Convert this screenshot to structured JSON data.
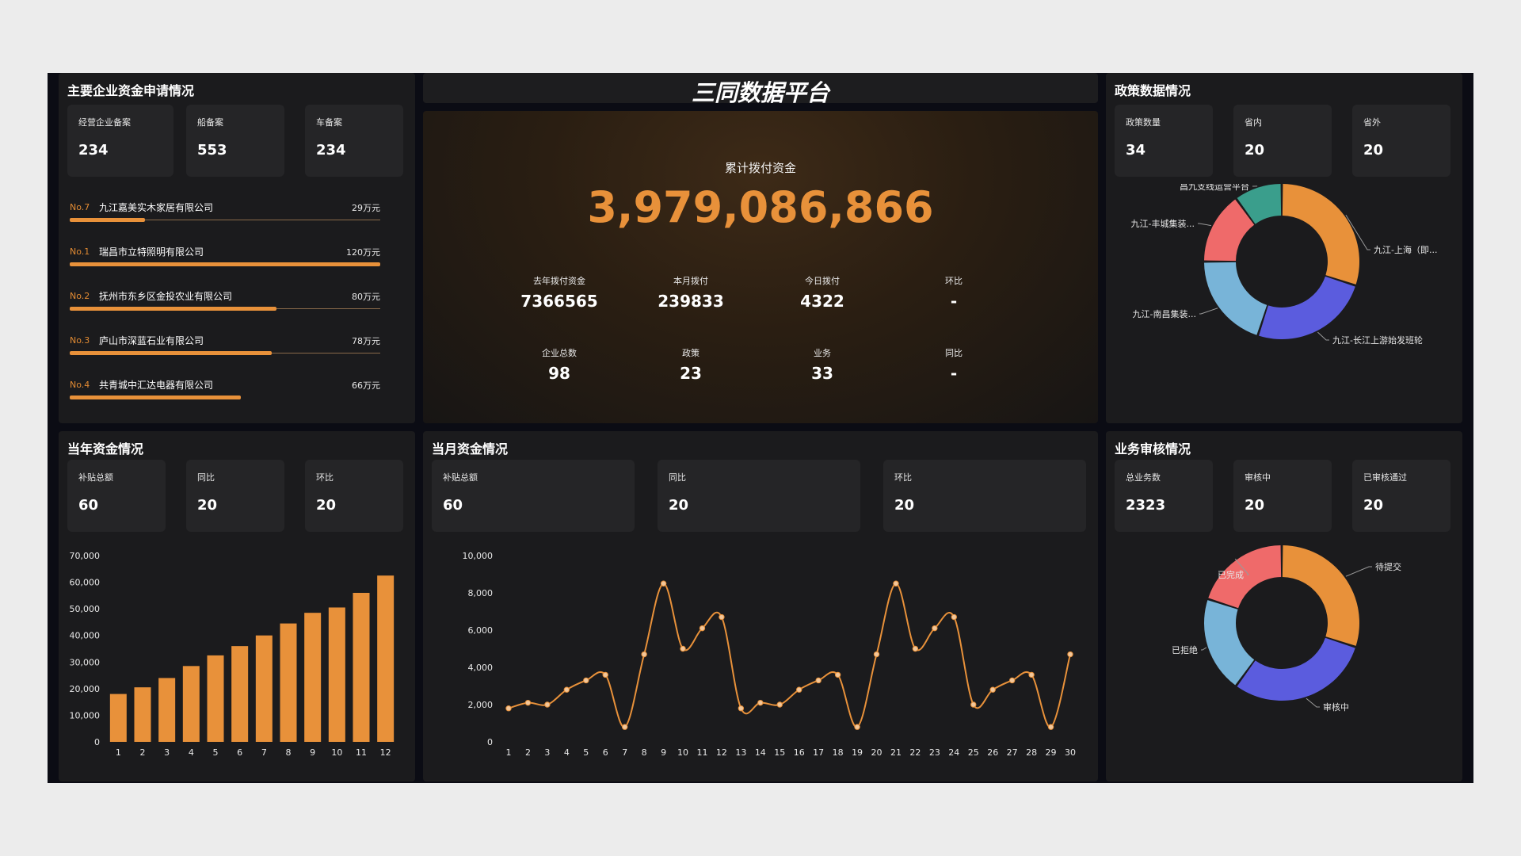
{
  "title": "三同数据平台",
  "colors": {
    "accent": "#e8913a",
    "panel": "#1b1b1d",
    "card": "#252527",
    "donut": [
      "#e8913a",
      "#5b5cde",
      "#78b4d8",
      "#ef6a6a",
      "#3a9e8c"
    ]
  },
  "enterprise": {
    "title": "主要企业资金申请情况",
    "stats": [
      {
        "label": "经营企业备案",
        "value": "234"
      },
      {
        "label": "船备案",
        "value": "553"
      },
      {
        "label": "车备案",
        "value": "234"
      }
    ],
    "ranks": [
      {
        "no": "No.7",
        "name": "九江嘉美实木家居有限公司",
        "amount": "29万元",
        "value": 29
      },
      {
        "no": "No.1",
        "name": "瑞昌市立特照明有限公司",
        "amount": "120万元",
        "value": 120
      },
      {
        "no": "No.2",
        "name": "抚州市东乡区金投农业有限公司",
        "amount": "80万元",
        "value": 80
      },
      {
        "no": "No.3",
        "name": "庐山市深蓝石业有限公司",
        "amount": "78万元",
        "value": 78
      },
      {
        "no": "No.4",
        "name": "共青城中汇达电器有限公司",
        "amount": "66万元",
        "value": 66
      }
    ]
  },
  "center": {
    "label": "累计拨付资金",
    "total": "3,979,086,866",
    "row1": [
      {
        "label": "去年拨付资金",
        "value": "7366565"
      },
      {
        "label": "本月拨付",
        "value": "239833"
      },
      {
        "label": "今日拨付",
        "value": "4322"
      },
      {
        "label": "环比",
        "value": "-"
      }
    ],
    "row2": [
      {
        "label": "企业总数",
        "value": "98"
      },
      {
        "label": "政策",
        "value": "23"
      },
      {
        "label": "业务",
        "value": "33"
      },
      {
        "label": "同比",
        "value": "-"
      }
    ]
  },
  "policy": {
    "title": "政策数据情况",
    "stats": [
      {
        "label": "政策数量",
        "value": "34"
      },
      {
        "label": "省内",
        "value": "20"
      },
      {
        "label": "省外",
        "value": "20"
      }
    ]
  },
  "yearFunds": {
    "title": "当年资金情况",
    "stats": [
      {
        "label": "补贴总额",
        "value": "60"
      },
      {
        "label": "同比",
        "value": "20"
      },
      {
        "label": "环比",
        "value": "20"
      }
    ]
  },
  "monthFunds": {
    "title": "当月资金情况",
    "stats": [
      {
        "label": "补贴总额",
        "value": "60"
      },
      {
        "label": "同比",
        "value": "20"
      },
      {
        "label": "环比",
        "value": "20"
      }
    ]
  },
  "audit": {
    "title": "业务审核情况",
    "stats": [
      {
        "label": "总业务数",
        "value": "2323"
      },
      {
        "label": "审核中",
        "value": "20"
      },
      {
        "label": "已审核通过",
        "value": "20"
      }
    ]
  },
  "chart_data": [
    {
      "id": "policy-donut",
      "type": "pie",
      "labels": [
        "九江-上海（即...",
        "九江-长江上游始发班轮",
        "九江-南昌集装...",
        "九江-丰城集装...",
        "昌九支线运营平台"
      ],
      "values": [
        30,
        25,
        20,
        15,
        10
      ]
    },
    {
      "id": "year-bar",
      "type": "bar",
      "categories": [
        "1",
        "2",
        "3",
        "4",
        "5",
        "6",
        "7",
        "8",
        "9",
        "10",
        "11",
        "12"
      ],
      "values": [
        18000,
        20500,
        24000,
        28500,
        32500,
        36000,
        40000,
        44500,
        48500,
        50500,
        56000,
        62500
      ],
      "ylim": [
        0,
        70000
      ],
      "yticks": [
        "0",
        "10,000",
        "20,000",
        "30,000",
        "40,000",
        "50,000",
        "60,000",
        "70,000"
      ],
      "grid": false
    },
    {
      "id": "month-line",
      "type": "line",
      "categories": [
        "1",
        "2",
        "3",
        "4",
        "5",
        "6",
        "7",
        "8",
        "9",
        "10",
        "11",
        "12",
        "13",
        "14",
        "15",
        "16",
        "17",
        "18",
        "19",
        "20",
        "21",
        "22",
        "23",
        "24",
        "25",
        "26",
        "27",
        "28",
        "29",
        "30"
      ],
      "values": [
        1800,
        2100,
        2000,
        2800,
        3300,
        3600,
        800,
        4700,
        8500,
        5000,
        6100,
        6700,
        1800,
        2100,
        2000,
        2800,
        3300,
        3600,
        800,
        4700,
        8500,
        5000,
        6100,
        6700,
        2000,
        2800,
        3300,
        3600,
        800,
        4700
      ],
      "ylim": [
        0,
        10000
      ],
      "yticks": [
        "0",
        "2,000",
        "4,000",
        "6,000",
        "8,000",
        "10,000"
      ],
      "grid": false
    },
    {
      "id": "audit-donut",
      "type": "pie",
      "labels": [
        "待提交",
        "审核中",
        "已拒绝",
        "已完成"
      ],
      "values": [
        30,
        30,
        20,
        20
      ]
    }
  ]
}
